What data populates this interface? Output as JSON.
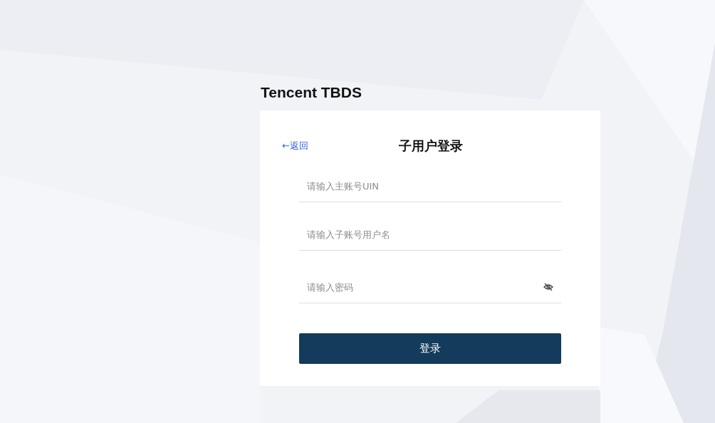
{
  "brand": {
    "title": "Tencent TBDS"
  },
  "login": {
    "back_link": "←返回",
    "heading": "子用户登录",
    "fields": [
      {
        "kind": "text",
        "placeholder": "请输入主账号UIN"
      },
      {
        "kind": "text",
        "placeholder": "请输入子账号用户名"
      },
      {
        "kind": "password",
        "placeholder": "请输入密码"
      }
    ],
    "submit": "登录"
  }
}
